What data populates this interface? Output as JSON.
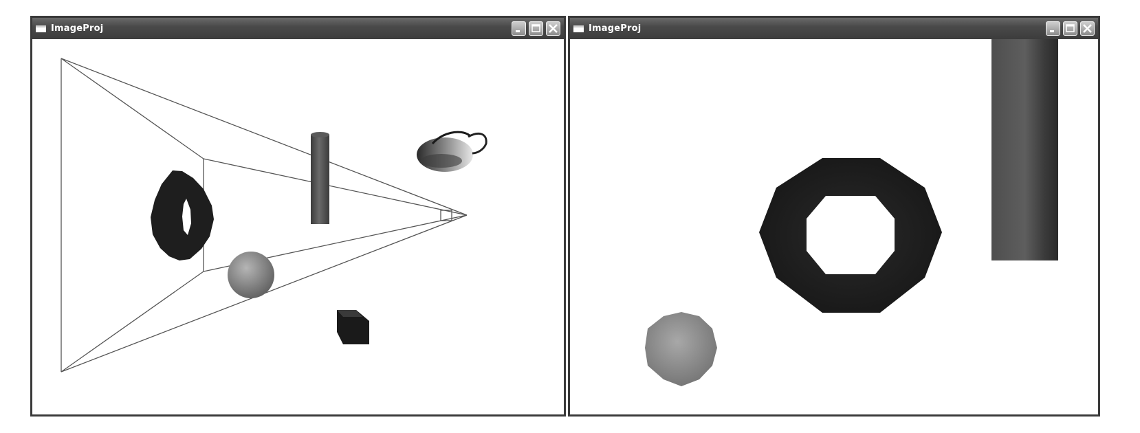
{
  "windows": [
    {
      "title": "ImageProj"
    },
    {
      "title": "ImageProj"
    }
  ],
  "icons": {
    "app": "window-icon",
    "minimize": "minimize-icon",
    "maximize": "maximize-icon",
    "close": "close-icon"
  },
  "colors": {
    "titlebar": "#444444",
    "frame": "#3a3a3a",
    "canvas_background": "#ffffff",
    "torus": "#1e1e1e",
    "box": "#1a1a1a",
    "cylinder": "#4a4a4a",
    "frustum_lines": "#555555"
  }
}
